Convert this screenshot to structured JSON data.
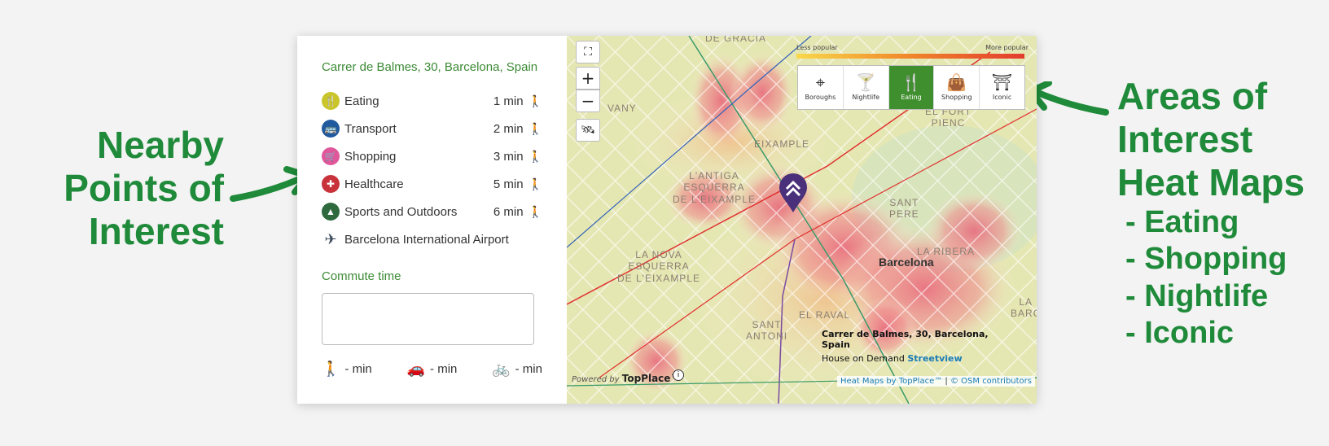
{
  "annotations": {
    "left_lines": [
      "Nearby",
      "Points of",
      "Interest"
    ],
    "right_lines": [
      "Areas of",
      "Interest",
      "Heat Maps"
    ],
    "right_sub": [
      "- Eating",
      "- Shopping",
      "- Nightlife",
      "- Iconic"
    ]
  },
  "panel": {
    "address": "Carrer de Balmes, 30, Barcelona, Spain",
    "pois": [
      {
        "name": "Eating",
        "time": "1 min",
        "icon": "fork-knife-icon",
        "color": "#c9c52b"
      },
      {
        "name": "Transport",
        "time": "2 min",
        "icon": "bus-icon",
        "color": "#1f5a9e"
      },
      {
        "name": "Shopping",
        "time": "3 min",
        "icon": "cart-icon",
        "color": "#e0579b"
      },
      {
        "name": "Healthcare",
        "time": "5 min",
        "icon": "health-cross-icon",
        "color": "#c8323a"
      },
      {
        "name": "Sports and Outdoors",
        "time": "6 min",
        "icon": "tree-icon",
        "color": "#2f6a3f"
      },
      {
        "name": "Barcelona International Airport",
        "time": "",
        "icon": "airplane-icon",
        "color": "#3b4a5a"
      }
    ],
    "commute_title": "Commute time",
    "modes": [
      {
        "icon": "walk-icon",
        "value": "- min"
      },
      {
        "icon": "car-icon",
        "value": "- min"
      },
      {
        "icon": "bike-icon",
        "value": "- min"
      }
    ]
  },
  "map": {
    "legend_less": "Less popular",
    "legend_more": "More popular",
    "layers": [
      {
        "label": "Boroughs",
        "icon": "map-pin-icon",
        "active": false
      },
      {
        "label": "Nightlife",
        "icon": "cocktail-icon",
        "active": false
      },
      {
        "label": "Eating",
        "icon": "fork-knife-icon",
        "active": true
      },
      {
        "label": "Shopping",
        "icon": "shopping-bag-icon",
        "active": false
      },
      {
        "label": "Iconic",
        "icon": "eiffel-tower-icon",
        "active": false
      }
    ],
    "labels": {
      "gracia": "DE GRÀCIA",
      "vany": "VANY",
      "fort_pienc": "EL FORT\nPIENC",
      "eixample": "EIXAMPLE",
      "antiga": "L'ANTIGA\nESQUERRA\nDE L'EIXAMPLE",
      "sant_pere": "SANT\nPERE",
      "nova": "LA NOVA\nESQUERRA\nDE L'EIXAMPLE",
      "ribera": "LA RIBERA",
      "raval": "EL RAVAL",
      "sant_antoni": "SANT\nANTONI",
      "la_barc": "LA BARC",
      "city": "Barcelona"
    },
    "info_address": "Carrer de Balmes, 30, Barcelona, Spain",
    "info_house": "House on Demand",
    "info_streetview": "Streetview",
    "powered_prefix": "Powered by",
    "powered_brand": "TopPlace™",
    "attribution_link": "Heat Maps by TopPlace™",
    "attribution_sep": " | ",
    "attribution_osm": "© OSM contributors",
    "brand_color": "#3f8f2e"
  }
}
